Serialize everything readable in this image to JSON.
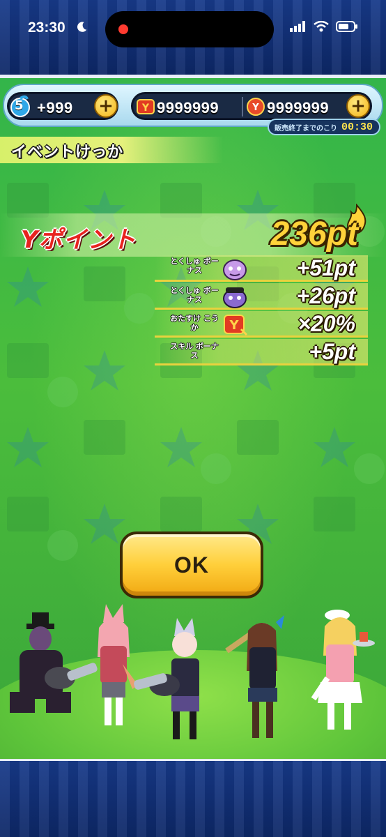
{
  "status_bar": {
    "time": "23:30",
    "icons": [
      "moon-icon",
      "recording-dot-icon",
      "signal-icon",
      "wifi-icon",
      "battery-icon"
    ]
  },
  "currency": {
    "stamina_level": "5",
    "stamina_count": "+999",
    "ymoney": "9999999",
    "ypoints": "9999999"
  },
  "timer": {
    "label": "販売終了までのこり",
    "value": "00:30"
  },
  "header": {
    "title": "イベントけっか"
  },
  "result": {
    "ypoint_label": "Yポイント",
    "ypoint_total": "236pt",
    "bonuses": [
      {
        "label": "とくしゅ ボーナス",
        "icon": "special-bonus-icon-1",
        "value": "+51pt"
      },
      {
        "label": "とくしゅ ボーナス",
        "icon": "special-bonus-icon-2",
        "value": "+26pt"
      },
      {
        "label": "おたすけ こうか",
        "icon": "assist-effect-icon",
        "value": "×20%"
      },
      {
        "label": "スキル ボーナス",
        "icon": "",
        "value": "+5pt"
      }
    ]
  },
  "ok_button": {
    "label": "OK"
  },
  "colors": {
    "bg_green": "#44b540",
    "ok_yellow": "#ffcf3a",
    "frame_blue": "#173a8a",
    "ypoint_red": "#e8231f"
  }
}
